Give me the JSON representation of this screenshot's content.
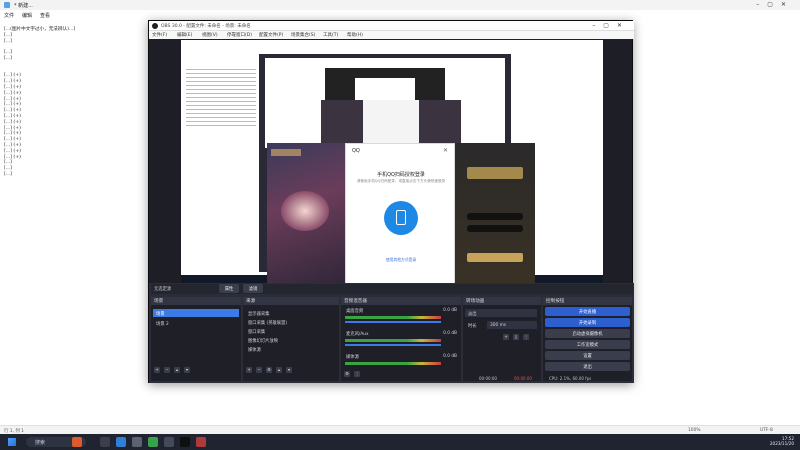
{
  "notepad": {
    "title": "* 新建...",
    "menu": [
      "文件",
      "编辑",
      "查看"
    ],
    "lines": [
      "[...(图片中文字过小，无法辨认)...]",
      "[...]",
      "[...]",
      "",
      "[...]",
      "[...]",
      "",
      "",
      "[...] (+)",
      "[...] (+)",
      "[...] (+)",
      "[...] (+)",
      "[...] (+)",
      "[...] (+)",
      "[...] (+)",
      "[...] (+)",
      "[...] (+)",
      "[...] (+)",
      "[...] (+)",
      "[...] (+)",
      "[...] (+)",
      "[...] (+)",
      "[...] (+)",
      "[...]",
      "[...]",
      "[...]"
    ],
    "status": {
      "left": "行 1, 列 1",
      "zoom": "100%",
      "encoding": "UTF-8"
    }
  },
  "taskbar": {
    "search_placeholder": "搜索",
    "time": "17:52",
    "date": "2023/11/20"
  },
  "obs": {
    "title": "OBS 30.0 - 配置文件: 未命名 - 场景: 未命名",
    "menu": [
      "文件(F)",
      "编辑(E)",
      "视图(V)",
      "停靠窗口(D)",
      "配置文件(P)",
      "场景集合(S)",
      "工具(T)",
      "帮助(H)"
    ],
    "preview_bar": {
      "label": "无选定源",
      "props": "属性",
      "filters": "滤镜"
    },
    "qq": {
      "brand": "QQ",
      "title": "手机QQ扫码授权登录",
      "subtitle": "请使用手机QQ扫码登录，或直接点击下方头像快速登录",
      "link": "使用其他方式登录"
    },
    "scenes": {
      "header": "场景",
      "items": [
        "场景",
        "场景 2"
      ]
    },
    "sources": {
      "header": "来源",
      "items": [
        "显示器采集",
        "窗口采集 (英雄联盟)",
        "窗口采集",
        "图像幻灯片放映",
        "媒体源"
      ]
    },
    "mixer": {
      "header": "音频混音器",
      "channels": [
        {
          "name": "桌面音频",
          "db": "0.0 dB"
        },
        {
          "name": "麦克风/Aux",
          "db": "0.0 dB"
        },
        {
          "name": "媒体源",
          "db": "0.0 dB"
        }
      ]
    },
    "transitions": {
      "header": "转场动画",
      "type": "淡出",
      "duration_label": "时长",
      "duration": "300 ms"
    },
    "controls": {
      "header": "控制按钮",
      "buttons": [
        "开始直播",
        "开始录制",
        "启动虚拟摄像机",
        "工作室模式",
        "设置",
        "退出"
      ]
    },
    "statusbar": {
      "live": "00:00:00",
      "rec": "00:00:00",
      "cpu": "CPU: 2.1%, 60.00 fps"
    }
  },
  "colors": {
    "accent": "#3c7be6",
    "obs_bg": "#1e1f26",
    "taskbar": "#1f2430"
  }
}
